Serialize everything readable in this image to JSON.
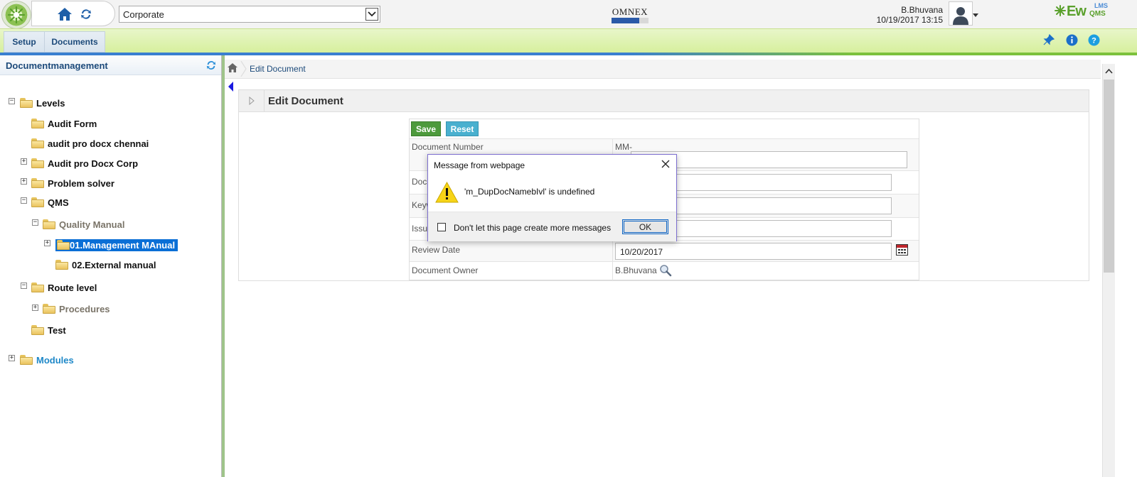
{
  "topbar": {
    "company_select": "Corporate",
    "omnex_logo_text": "OMNEX",
    "user_name": "B.Bhuvana",
    "datetime": "10/19/2017 13:15",
    "brand": {
      "ew": "Ew",
      "lms": "LMS",
      "qms": "QMS"
    }
  },
  "menu": {
    "setup": "Setup",
    "documents": "Documents"
  },
  "sidebar": {
    "title": "Documentmanagement",
    "tree": {
      "levels": "Levels",
      "audit_form": "Audit Form",
      "audit_pro_chennai": "audit pro docx chennai",
      "audit_pro_corp": "Audit pro Docx Corp",
      "problem_solver": "Problem solver",
      "qms": "QMS",
      "quality_manual": "Quality Manual",
      "management_manual": "01.Management MAnual",
      "external_manual": "02.External manual",
      "route_level": "Route level",
      "procedures": "Procedures",
      "test": "Test",
      "modules": "Modules"
    }
  },
  "breadcrumb": {
    "current": "Edit Document"
  },
  "panel": {
    "title": "Edit Document"
  },
  "form": {
    "save_label": "Save",
    "reset_label": "Reset",
    "fields": {
      "doc_number_label": "Document Number",
      "doc_number_prefix": "MM-",
      "doc_name_label": "Doc",
      "keywords_label": "Keyw",
      "issue_label": "Issu",
      "review_date_label": "Review Date",
      "review_date_value": "10/20/2017",
      "owner_label": "Document Owner",
      "owner_value": "B.Bhuvana"
    }
  },
  "dialog": {
    "title": "Message from webpage",
    "message": "'m_DupDocNamebIvl' is undefined",
    "checkbox_label": "Don't let this page create more messages",
    "ok_label": "OK"
  },
  "colors": {
    "accent_blue": "#1c4a7a",
    "menu_green": "#d6ef9c",
    "save_green": "#4d9a3c",
    "reset_blue": "#49b0cf",
    "selected_blue": "#0a6fd6"
  }
}
